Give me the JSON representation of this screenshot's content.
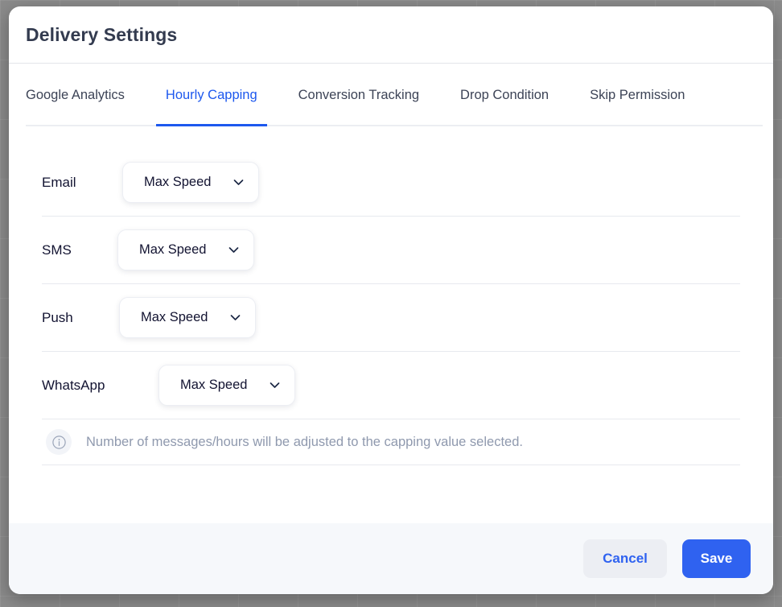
{
  "dialog": {
    "title": "Delivery Settings"
  },
  "tabs": [
    {
      "label": "Google Analytics",
      "active": false
    },
    {
      "label": "Hourly Capping",
      "active": true
    },
    {
      "label": "Conversion Tracking",
      "active": false
    },
    {
      "label": "Drop Condition",
      "active": false
    },
    {
      "label": "Skip Permission",
      "active": false
    }
  ],
  "rows": [
    {
      "label": "Email",
      "value": "Max Speed",
      "chevron_icon": "chevron-down-icon"
    },
    {
      "label": "SMS",
      "value": "Max Speed",
      "chevron_icon": "chevron-down-icon"
    },
    {
      "label": "Push",
      "value": "Max Speed",
      "chevron_icon": "chevron-down-icon"
    },
    {
      "label": "WhatsApp",
      "value": "Max Speed",
      "chevron_icon": "chevron-down-icon"
    }
  ],
  "info": {
    "icon": "info-circle-icon",
    "text": "Number of messages/hours will be adjusted to the capping value selected."
  },
  "footer": {
    "cancel_label": "Cancel",
    "save_label": "Save"
  },
  "colors": {
    "accent_blue": "#2f62f0",
    "active_tab_blue": "#1d58ee",
    "title_slate": "#333b4f",
    "label_navy": "#121331",
    "muted_text": "#8f99ae",
    "footer_bg": "#f6f8fb",
    "divider": "#e7e9ef"
  }
}
